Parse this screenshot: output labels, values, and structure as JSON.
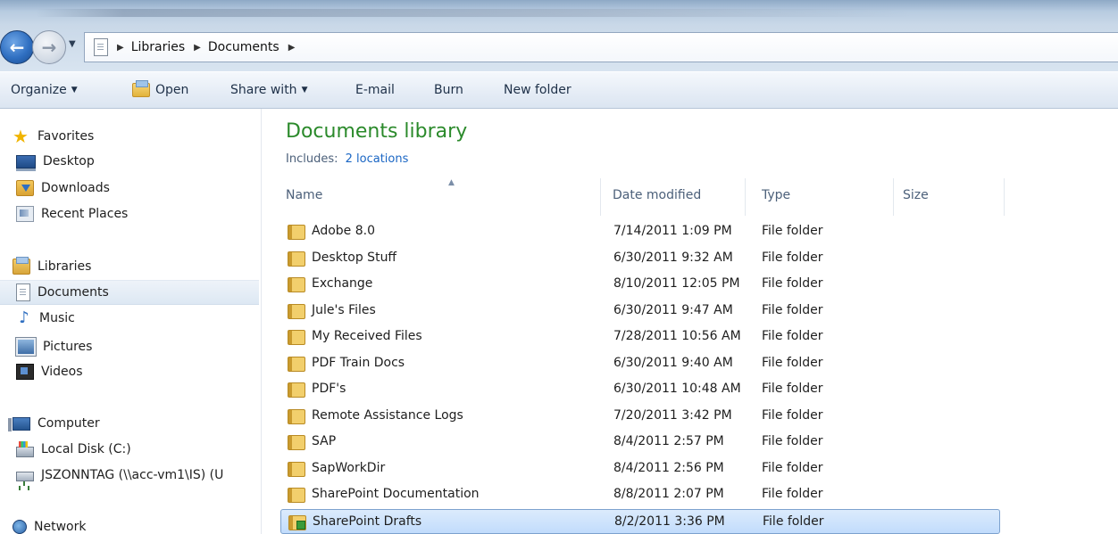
{
  "breadcrumb": [
    "Libraries",
    "Documents"
  ],
  "toolbar": {
    "organize": "Organize",
    "open": "Open",
    "share_with": "Share with",
    "email": "E-mail",
    "burn": "Burn",
    "new_folder": "New folder"
  },
  "sidebar": {
    "favorites": {
      "label": "Favorites",
      "items": [
        "Desktop",
        "Downloads",
        "Recent Places"
      ]
    },
    "libraries": {
      "label": "Libraries",
      "items": [
        "Documents",
        "Music",
        "Pictures",
        "Videos"
      ],
      "selected": "Documents"
    },
    "computer": {
      "label": "Computer",
      "items": [
        "Local Disk (C:)",
        "JSZONNTAG (\\\\acc-vm1\\IS) (U"
      ]
    },
    "network": {
      "label": "Network"
    }
  },
  "main": {
    "title": "Documents library",
    "includes_label": "Includes:",
    "includes_link": "2 locations",
    "columns": {
      "name": "Name",
      "date": "Date modified",
      "type": "Type",
      "size": "Size"
    },
    "rows": [
      {
        "name": "Adobe 8.0",
        "date": "7/14/2011 1:09 PM",
        "type": "File folder"
      },
      {
        "name": "Desktop Stuff",
        "date": "6/30/2011 9:32 AM",
        "type": "File folder"
      },
      {
        "name": "Exchange",
        "date": "8/10/2011 12:05 PM",
        "type": "File folder"
      },
      {
        "name": "Jule's Files",
        "date": "6/30/2011 9:47 AM",
        "type": "File folder"
      },
      {
        "name": "My Received Files",
        "date": "7/28/2011 10:56 AM",
        "type": "File folder"
      },
      {
        "name": "PDF Train Docs",
        "date": "6/30/2011 9:40 AM",
        "type": "File folder"
      },
      {
        "name": "PDF's",
        "date": "6/30/2011 10:48 AM",
        "type": "File folder"
      },
      {
        "name": "Remote Assistance Logs",
        "date": "7/20/2011 3:42 PM",
        "type": "File folder"
      },
      {
        "name": "SAP",
        "date": "8/4/2011 2:57 PM",
        "type": "File folder"
      },
      {
        "name": "SapWorkDir",
        "date": "8/4/2011 2:56 PM",
        "type": "File folder"
      },
      {
        "name": "SharePoint Documentation",
        "date": "8/8/2011 2:07 PM",
        "type": "File folder"
      },
      {
        "name": "SharePoint Drafts",
        "date": "8/2/2011 3:36 PM",
        "type": "File folder"
      }
    ],
    "selected_row": "SharePoint Drafts"
  }
}
